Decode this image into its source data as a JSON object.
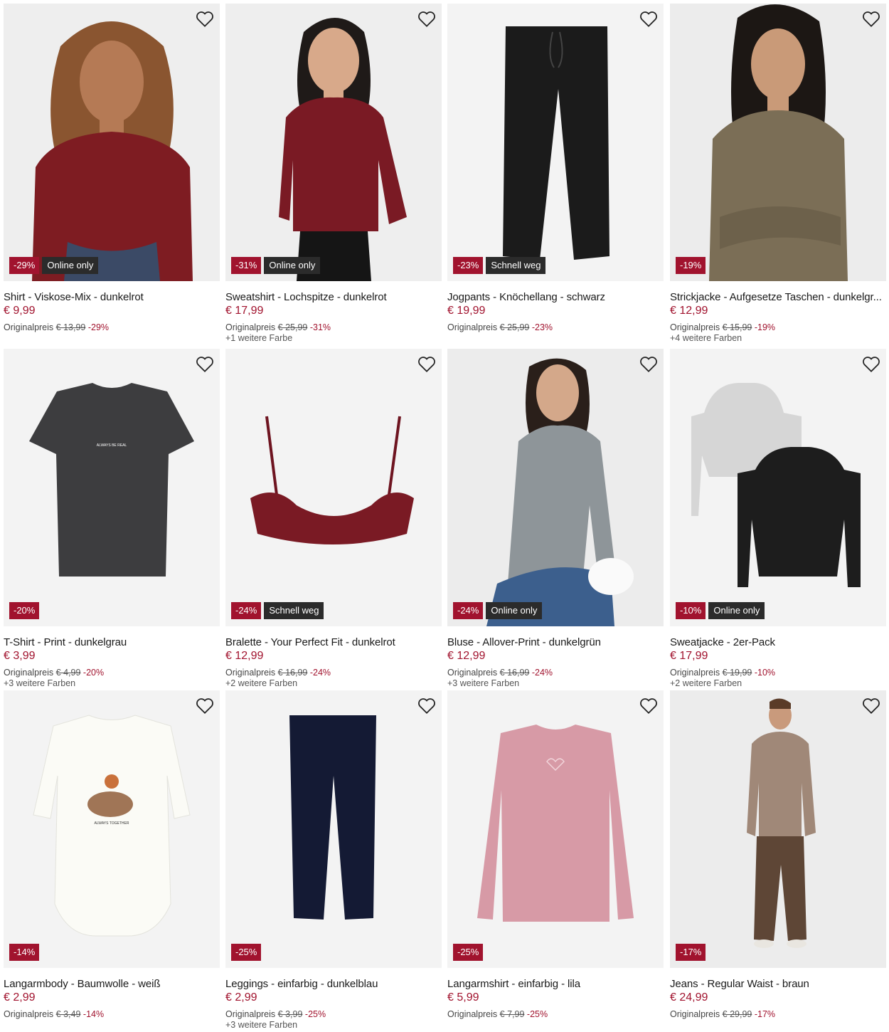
{
  "products": [
    {
      "title": "Shirt - Viskose-Mix - dunkelrot",
      "price": "€ 9,99",
      "orig_label": "Originalpreis",
      "orig_price": "€ 13,99",
      "discount": "-29%",
      "tag": "Online only",
      "more": ""
    },
    {
      "title": "Sweatshirt - Lochspitze - dunkelrot",
      "price": "€ 17,99",
      "orig_label": "Originalpreis",
      "orig_price": "€ 25,99",
      "discount": "-31%",
      "tag": "Online only",
      "more": "+1 weitere Farbe"
    },
    {
      "title": "Jogpants - Knöchellang - schwarz",
      "price": "€ 19,99",
      "orig_label": "Originalpreis",
      "orig_price": "€ 25,99",
      "discount": "-23%",
      "tag": "Schnell weg",
      "more": ""
    },
    {
      "title": "Strickjacke - Aufgesetze Taschen - dunkelgr...",
      "price": "€ 12,99",
      "orig_label": "Originalpreis",
      "orig_price": "€ 15,99",
      "discount": "-19%",
      "tag": "",
      "more": "+4 weitere Farben"
    },
    {
      "title": "T-Shirt - Print - dunkelgrau",
      "price": "€ 3,99",
      "orig_label": "Originalpreis",
      "orig_price": "€ 4,99",
      "discount": "-20%",
      "tag": "",
      "more": "+3 weitere Farben"
    },
    {
      "title": "Bralette - Your Perfect Fit - dunkelrot",
      "price": "€ 12,99",
      "orig_label": "Originalpreis",
      "orig_price": "€ 16,99",
      "discount": "-24%",
      "tag": "Schnell weg",
      "more": "+2 weitere Farben"
    },
    {
      "title": "Bluse - Allover-Print - dunkelgrün",
      "price": "€ 12,99",
      "orig_label": "Originalpreis",
      "orig_price": "€ 16,99",
      "discount": "-24%",
      "tag": "Online only",
      "more": "+3 weitere Farben"
    },
    {
      "title": "Sweatjacke - 2er-Pack",
      "price": "€ 17,99",
      "orig_label": "Originalpreis",
      "orig_price": "€ 19,99",
      "discount": "-10%",
      "tag": "Online only",
      "more": "+2 weitere Farben"
    },
    {
      "title": "Langarmbody - Baumwolle - weiß",
      "price": "€ 2,99",
      "orig_label": "Originalpreis",
      "orig_price": "€ 3,49",
      "discount": "-14%",
      "tag": "",
      "more": ""
    },
    {
      "title": "Leggings - einfarbig - dunkelblau",
      "price": "€ 2,99",
      "orig_label": "Originalpreis",
      "orig_price": "€ 3,99",
      "discount": "-25%",
      "tag": "",
      "more": "+3 weitere Farben"
    },
    {
      "title": "Langarmshirt - einfarbig - lila",
      "price": "€ 5,99",
      "orig_label": "Originalpreis",
      "orig_price": "€ 7,99",
      "discount": "-25%",
      "tag": "",
      "more": ""
    },
    {
      "title": "Jeans - Regular Waist - braun",
      "price": "€ 24,99",
      "orig_label": "Originalpreis",
      "orig_price": "€ 29,99",
      "discount": "-17%",
      "tag": "",
      "more": ""
    }
  ],
  "colors": {
    "accent": "#a1132e",
    "tag_bg": "#2b2b2b",
    "image_bg": "#f2f2f2"
  },
  "icons": {
    "wishlist": "heart-outline-icon"
  },
  "print_texts": {
    "tshirt": "ALWAYS BE REAL",
    "body": "ALWAYS TOGETHER"
  }
}
